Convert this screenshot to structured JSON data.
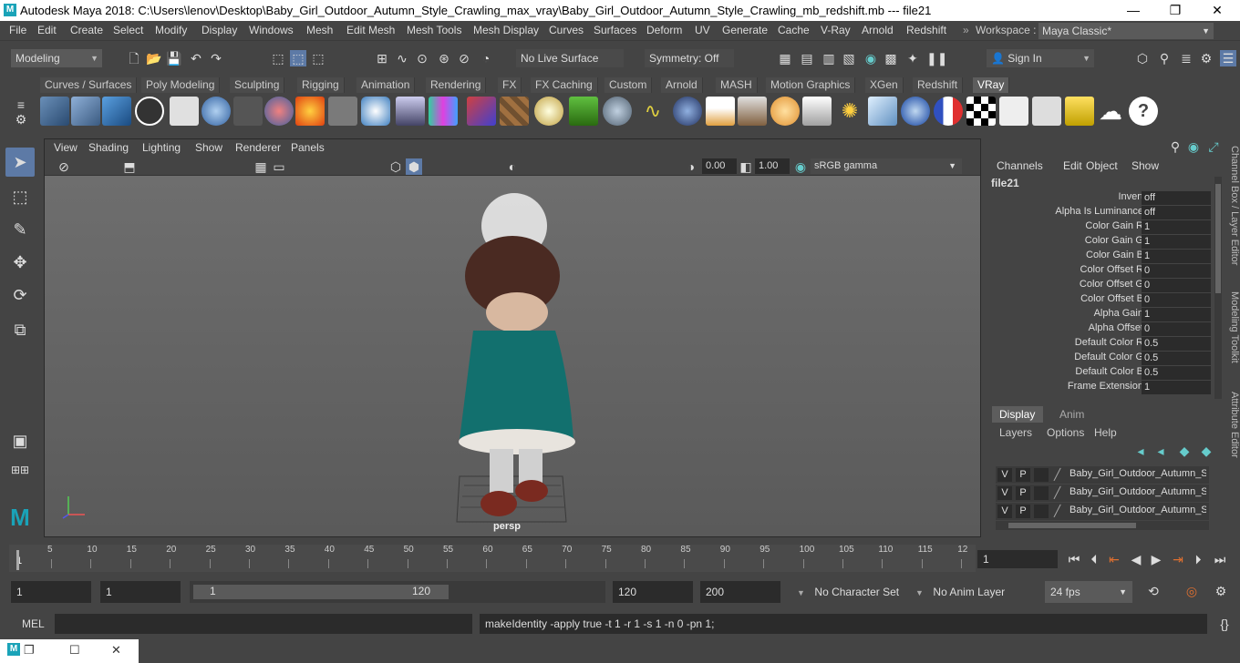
{
  "title_bar": {
    "text": "Autodesk Maya 2018: C:\\Users\\lenov\\Desktop\\Baby_Girl_Outdoor_Autumn_Style_Crawling_max_vray\\Baby_Girl_Outdoor_Autumn_Style_Crawling_mb_redshift.mb   ---   file21",
    "minimize": "—",
    "maximize": "❐",
    "close": "✕"
  },
  "menus": [
    "File",
    "Edit",
    "Create",
    "Select",
    "Modify",
    "Display",
    "Windows",
    "Mesh",
    "Edit Mesh",
    "Mesh Tools",
    "Mesh Display",
    "Curves",
    "Surfaces",
    "Deform",
    "UV",
    "Generate",
    "Cache",
    "V-Ray",
    "Arnold",
    "Redshift"
  ],
  "workspace": {
    "label": "Workspace :",
    "value": "Maya Classic*"
  },
  "status_line": {
    "mode": "Modeling",
    "live_surface": "No Live Surface",
    "symmetry": "Symmetry: Off",
    "sign_in": "Sign In"
  },
  "shelf_tabs": [
    "Curves / Surfaces",
    "Poly Modeling",
    "Sculpting",
    "Rigging",
    "Animation",
    "Rendering",
    "FX",
    "FX Caching",
    "Custom",
    "Arnold",
    "MASH",
    "Motion Graphics",
    "XGen",
    "Redshift",
    "VRay"
  ],
  "active_shelf_tab": "VRay",
  "viewport": {
    "menus": [
      "View",
      "Shading",
      "Lighting",
      "Show",
      "Renderer",
      "Panels"
    ],
    "exposure": "0.00",
    "gamma": "1.00",
    "color_space": "sRGB gamma",
    "camera_label": "persp"
  },
  "channel_box": {
    "menus": [
      "Channels",
      "Edit",
      "Object",
      "Show"
    ],
    "node": "file21",
    "attributes": [
      {
        "label": "Invert",
        "value": "off"
      },
      {
        "label": "Alpha Is Luminance",
        "value": "off"
      },
      {
        "label": "Color Gain R",
        "value": "1"
      },
      {
        "label": "Color Gain G",
        "value": "1"
      },
      {
        "label": "Color Gain B",
        "value": "1"
      },
      {
        "label": "Color Offset R",
        "value": "0"
      },
      {
        "label": "Color Offset G",
        "value": "0"
      },
      {
        "label": "Color Offset B",
        "value": "0"
      },
      {
        "label": "Alpha Gain",
        "value": "1"
      },
      {
        "label": "Alpha Offset",
        "value": "0"
      },
      {
        "label": "Default Color R",
        "value": "0.5"
      },
      {
        "label": "Default Color G",
        "value": "0.5"
      },
      {
        "label": "Default Color B",
        "value": "0.5"
      },
      {
        "label": "Frame Extension",
        "value": "1"
      }
    ]
  },
  "layer_editor": {
    "tabs": [
      "Display",
      "Anim"
    ],
    "menus": [
      "Layers",
      "Options",
      "Help"
    ],
    "layers": [
      {
        "v": "V",
        "p": "P",
        "name": "Baby_Girl_Outdoor_Autumn_S"
      },
      {
        "v": "V",
        "p": "P",
        "name": "Baby_Girl_Outdoor_Autumn_S"
      },
      {
        "v": "V",
        "p": "P",
        "name": "Baby_Girl_Outdoor_Autumn_S"
      }
    ]
  },
  "side_tabs": [
    "Channel Box / Layer Editor",
    "Modeling Toolkit",
    "Attribute Editor"
  ],
  "timeline": {
    "ticks": [
      "5",
      "10",
      "15",
      "20",
      "25",
      "30",
      "35",
      "40",
      "45",
      "50",
      "55",
      "60",
      "65",
      "70",
      "75",
      "80",
      "85",
      "90",
      "95",
      "100",
      "105",
      "110",
      "115",
      "12"
    ],
    "start_marker": "1",
    "current_frame": "1"
  },
  "range": {
    "start": "1",
    "playback_start": "1",
    "slider_start": "1",
    "slider_end": "120",
    "playback_end": "120",
    "end": "200",
    "character_set": "No Character Set",
    "anim_layer": "No Anim Layer",
    "fps": "24 fps"
  },
  "command_line": {
    "lang": "MEL",
    "result": "makeIdentity -apply true -t 1 -r 1 -s 1 -n 0 -pn 1;"
  },
  "colors": {
    "accent": "#5d7aa6",
    "maya_teal": "#1aa3b8"
  }
}
